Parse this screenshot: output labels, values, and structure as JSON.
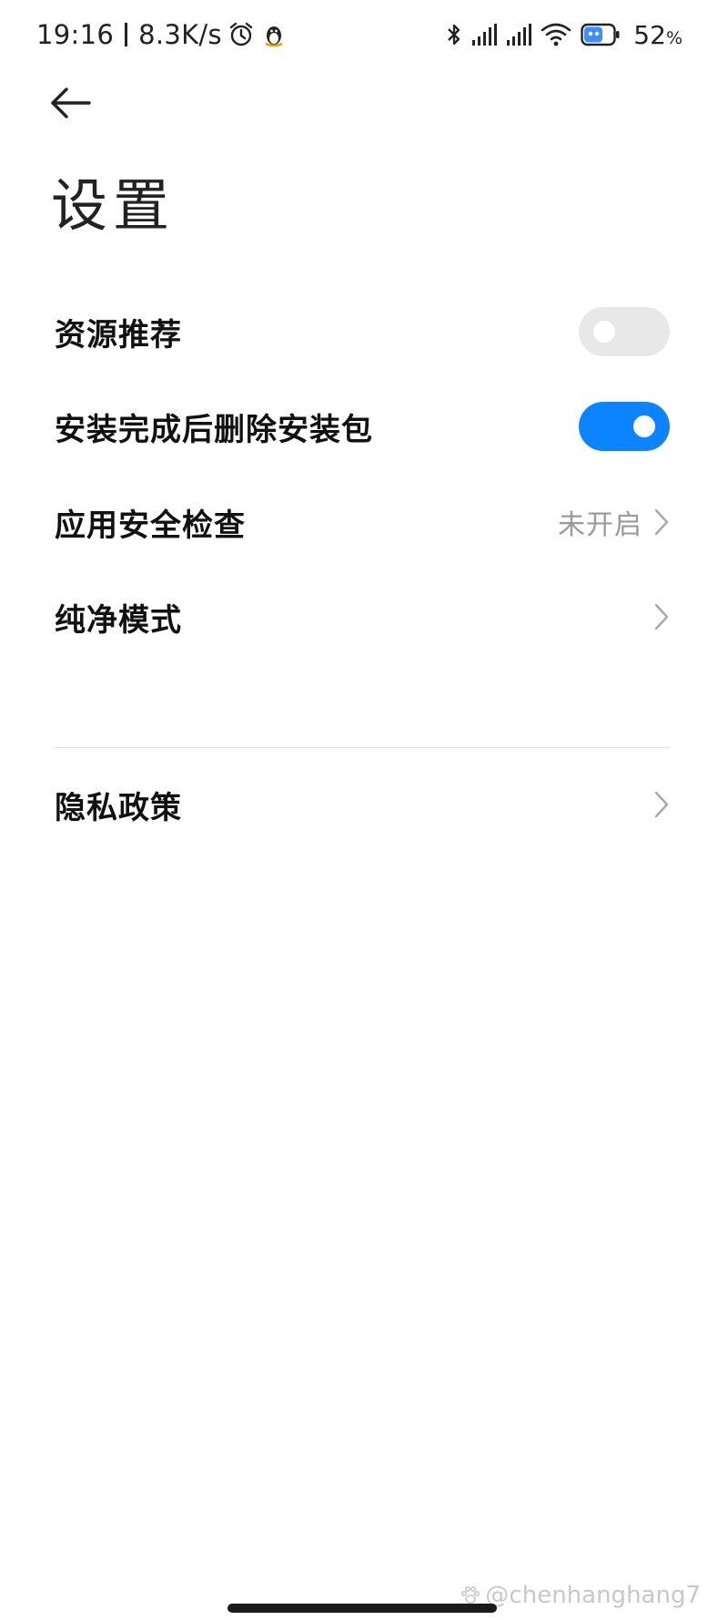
{
  "status_bar": {
    "time": "19:16",
    "net_speed": "8.3K/s",
    "battery_level": "52",
    "battery_unit": "%",
    "icons": [
      "alarm-icon",
      "qq-penguin-icon",
      "bluetooth-icon",
      "signal-icon",
      "signal-icon",
      "wifi-icon",
      "battery-icon"
    ]
  },
  "header": {
    "back_icon": "back-arrow-icon",
    "title": "设置"
  },
  "settings": {
    "items": [
      {
        "label": "资源推荐",
        "control": "toggle",
        "state": "off"
      },
      {
        "label": "安装完成后删除安装包",
        "control": "toggle",
        "state": "on"
      },
      {
        "label": "应用安全检查",
        "control": "link",
        "value": "未开启"
      },
      {
        "label": "纯净模式",
        "control": "link"
      },
      {
        "label": "隐私政策",
        "control": "link"
      }
    ]
  },
  "watermark": "@chenhanghang7",
  "colors": {
    "accent": "#0d84ff",
    "toggle_off": "#e8e8e8",
    "secondary_text": "#9a9a9a"
  }
}
